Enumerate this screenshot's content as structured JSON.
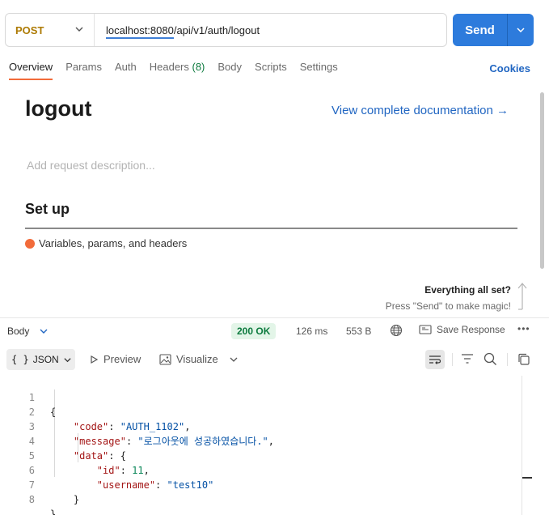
{
  "request": {
    "method": "POST",
    "url": "localhost:8080/api/v1/auth/logout",
    "send_label": "Send"
  },
  "tabs": [
    {
      "label": "Overview",
      "active": true
    },
    {
      "label": "Params"
    },
    {
      "label": "Auth"
    },
    {
      "label": "Headers",
      "count": "(8)"
    },
    {
      "label": "Body"
    },
    {
      "label": "Scripts"
    },
    {
      "label": "Settings"
    }
  ],
  "cookies_label": "Cookies",
  "overview": {
    "title": "logout",
    "doc_link": "View complete documentation →",
    "description_placeholder": "Add request description...",
    "setup_heading": "Set up",
    "setup_item": "Variables, params, and headers",
    "hint_title": "Everything all set?",
    "hint_sub": "Press \"Send\" to make magic!"
  },
  "response": {
    "body_label": "Body",
    "status": "200 OK",
    "time": "126 ms",
    "size": "553 B",
    "save_label": "Save Response",
    "format": "JSON",
    "preview_label": "Preview",
    "visualize_label": "Visualize",
    "line_numbers": [
      "1",
      "2",
      "3",
      "4",
      "5",
      "6",
      "7",
      "8"
    ],
    "json": {
      "code_key": "\"code\"",
      "code_val": "\"AUTH_1102\"",
      "message_key": "\"message\"",
      "message_val": "\"로그아웃에 성공하였습니다.\"",
      "data_key": "\"data\"",
      "id_key": "\"id\"",
      "id_val": "11",
      "username_key": "\"username\"",
      "username_val": "\"test10\""
    }
  },
  "colors": {
    "accent": "#2d7bdc",
    "method": "#ad7a03",
    "tab_active": "#f26b3a",
    "status_ok": "#0c7a3e"
  }
}
